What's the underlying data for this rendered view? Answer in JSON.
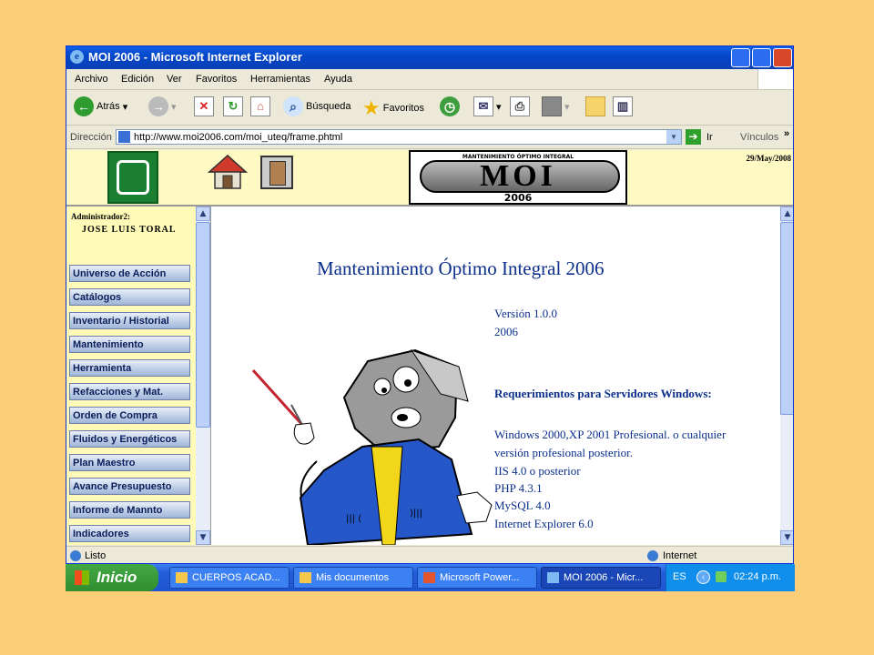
{
  "window": {
    "title": "MOI 2006 - Microsoft Internet Explorer"
  },
  "menu": [
    "Archivo",
    "Edición",
    "Ver",
    "Favoritos",
    "Herramientas",
    "Ayuda"
  ],
  "toolbar": {
    "back": "Atrás",
    "search": "Búsqueda",
    "favorites": "Favoritos"
  },
  "address": {
    "label": "Dirección",
    "url": "http://www.moi2006.com/moi_uteq/frame.phtml",
    "go": "Ir",
    "links": "Vínculos",
    "more": "»"
  },
  "header": {
    "logo_subtitle": "MANTENIMIENTO ÓPTIMO INTEGRAL",
    "logo_text": "MOI",
    "logo_year": "2006",
    "date": "29/May/2008"
  },
  "sidebar": {
    "admin_label": "Administrador2:",
    "user_name": "JOSE LUIS TORAL",
    "items": [
      "Universo de Acción",
      "Catálogos",
      "Inventario / Historial",
      "Mantenimiento",
      "Herramienta",
      "Refacciones y Mat.",
      "Orden de Compra",
      "Fluidos y Energéticos",
      "Plan Maestro",
      "Avance Presupuesto",
      "Informe de Mannto",
      "Indicadores"
    ]
  },
  "main": {
    "heading": "Mantenimiento Óptimo Integral 2006",
    "version": "Versión 1.0.0",
    "year": "2006",
    "requirements_title": "Requerimientos para Servidores Windows:",
    "requirements": [
      "Windows 2000,XP 2001 Profesional. o cualquier",
      "versión profesional posterior.",
      "IIS 4.0 o posterior",
      "PHP 4.3.1",
      "MySQL 4.0",
      "Internet Explorer 6.0"
    ]
  },
  "status": {
    "left": "Listo",
    "zone": "Internet"
  },
  "taskbar": {
    "start": "Inicio",
    "buttons": [
      "CUERPOS ACAD...",
      "Mis documentos",
      "Microsoft Power...",
      "MOI 2006 - Micr..."
    ],
    "lang": "ES",
    "time": "02:24 p.m."
  }
}
